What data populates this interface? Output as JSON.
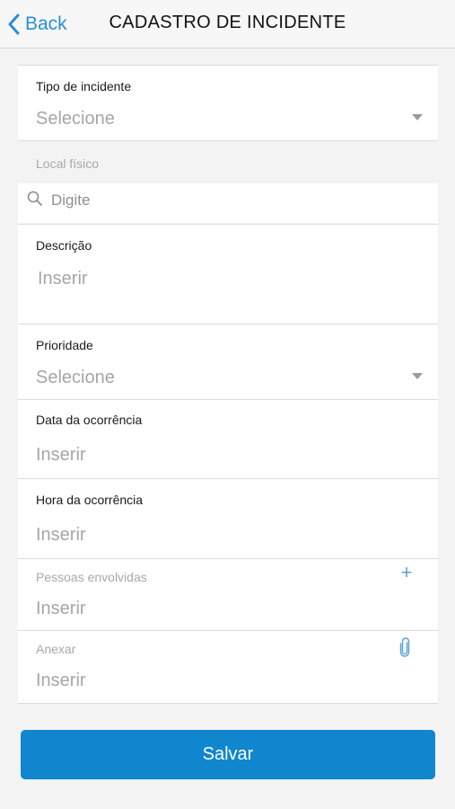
{
  "header": {
    "back_label": "Back",
    "title": "CADASTRO DE INCIDENTE"
  },
  "form": {
    "tipo": {
      "label": "Tipo de incidente",
      "value": "Selecione"
    },
    "local": {
      "label": "Local físico",
      "placeholder": "Digite"
    },
    "descricao": {
      "label": "Descrição",
      "placeholder": "Inserir"
    },
    "prioridade": {
      "label": "Prioridade",
      "value": "Selecione"
    },
    "data": {
      "label": "Data da ocorrência",
      "placeholder": "Inserir"
    },
    "hora": {
      "label": "Hora da ocorrência",
      "placeholder": "Inserir"
    },
    "pessoas": {
      "label": "Pessoas envolvidas",
      "placeholder": "Inserir",
      "action_icon": "plus-icon"
    },
    "anexo": {
      "label": "Anexar",
      "placeholder": "Inserir",
      "action_icon": "paperclip-icon"
    }
  },
  "actions": {
    "save_label": "Salvar"
  },
  "colors": {
    "accent": "#0f86cd",
    "link": "#2a8fd6",
    "background": "#f3f3f3"
  }
}
